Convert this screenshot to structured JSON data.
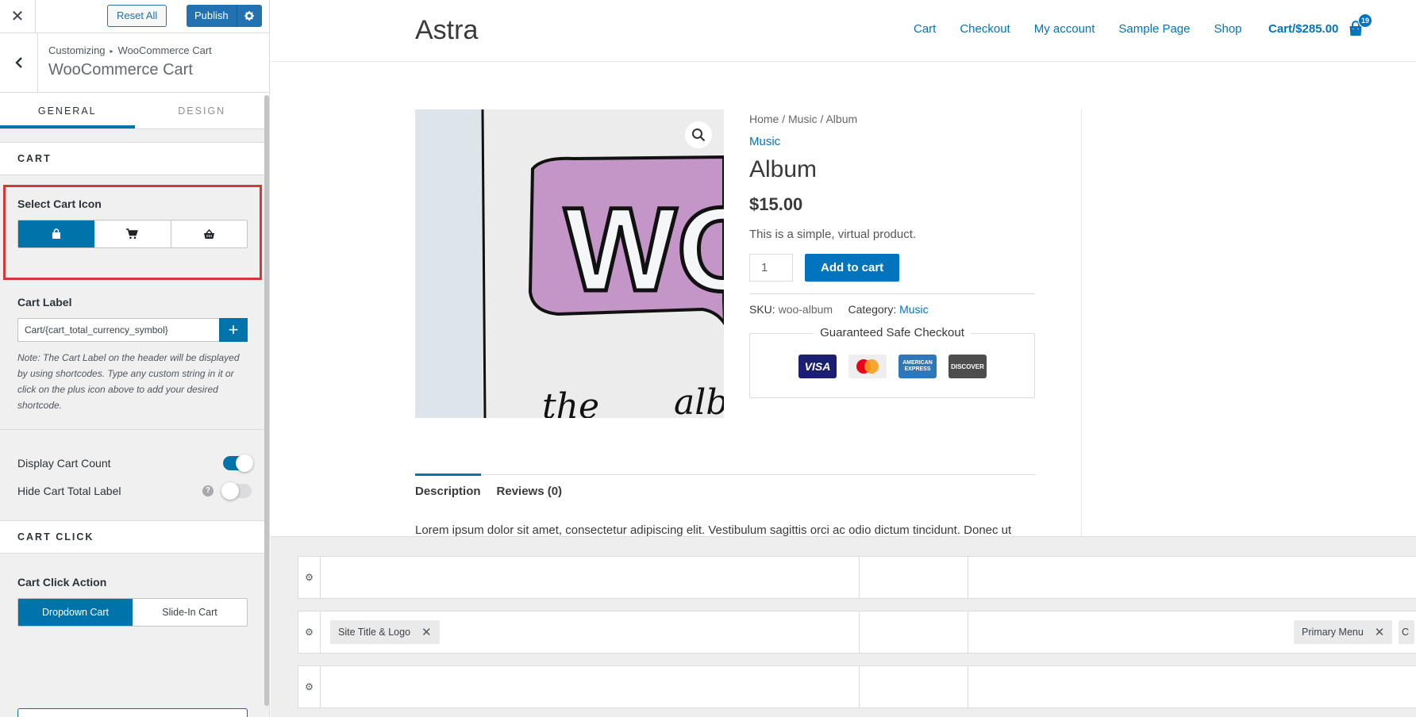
{
  "sidebar": {
    "close_glyph": "✕",
    "reset_label": "Reset All",
    "publish_label": "Publish",
    "breadcrumb": {
      "root": "Customizing",
      "sep": "▸",
      "current": "WooCommerce Cart"
    },
    "title": "WooCommerce Cart",
    "tabs": [
      {
        "label": "GENERAL"
      },
      {
        "label": "DESIGN"
      }
    ],
    "cart_section": {
      "heading": "CART",
      "select_icon_label": "Select Cart Icon",
      "cart_label_label": "Cart Label",
      "cart_label_value": "Cart/{cart_total_currency_symbol}",
      "plus_glyph": "+",
      "note": "Note: The Cart Label on the header will be displayed by using shortcodes. Type any custom string in it or click on the plus icon above to add your desired shortcode.",
      "display_count_label": "Display Cart Count",
      "hide_total_label": "Hide Cart Total Label",
      "help_glyph": "?"
    },
    "cart_click": {
      "heading": "CART CLICK",
      "action_label": "Cart Click Action",
      "options": [
        {
          "label": "Dropdown Cart"
        },
        {
          "label": "Slide-In Cart"
        }
      ]
    }
  },
  "preview": {
    "site_title": "Astra",
    "nav": [
      {
        "label": "Cart"
      },
      {
        "label": "Checkout"
      },
      {
        "label": "My account"
      },
      {
        "label": "Sample Page"
      },
      {
        "label": "Shop"
      }
    ],
    "cart_link": "Cart/$285.00",
    "cart_count": "19",
    "product": {
      "breadcrumb": "Home / Music / Album",
      "category": "Music",
      "title": "Album",
      "price": "$15.00",
      "short_desc": "This is a simple, virtual product.",
      "qty": "1",
      "add_label": "Add to cart",
      "sku_label": "SKU:",
      "sku_value": "woo-album",
      "category_label": "Category:",
      "category_value": "Music",
      "safe_checkout": "Guaranteed Safe Checkout",
      "image_text_1": "WO",
      "image_text_2": "the",
      "image_text_3": "alb",
      "cards": [
        {
          "label": "VISA",
          "color": "#1a1f71"
        },
        {
          "label": "",
          "color": "#eeeeee"
        },
        {
          "label": "AMERICAN EXPRESS",
          "color": "#2e77bb"
        },
        {
          "label": "DISCOVER",
          "color": "#4d4d4d"
        }
      ]
    },
    "tabs": [
      {
        "label": "Description"
      },
      {
        "label": "Reviews (0)"
      }
    ],
    "description": "Lorem ipsum dolor sit amet, consectetur adipiscing elit. Vestibulum sagittis orci ac odio dictum tincidunt. Donec ut"
  },
  "builder": {
    "gear_glyph": "⚙",
    "chip_close": "✕",
    "chips": {
      "site_title": "Site Title & Logo",
      "primary_menu": "Primary Menu",
      "partial": "C"
    }
  },
  "colors": {
    "accent": "#0073aa",
    "link": "#0274be",
    "highlight": "#d63638"
  }
}
